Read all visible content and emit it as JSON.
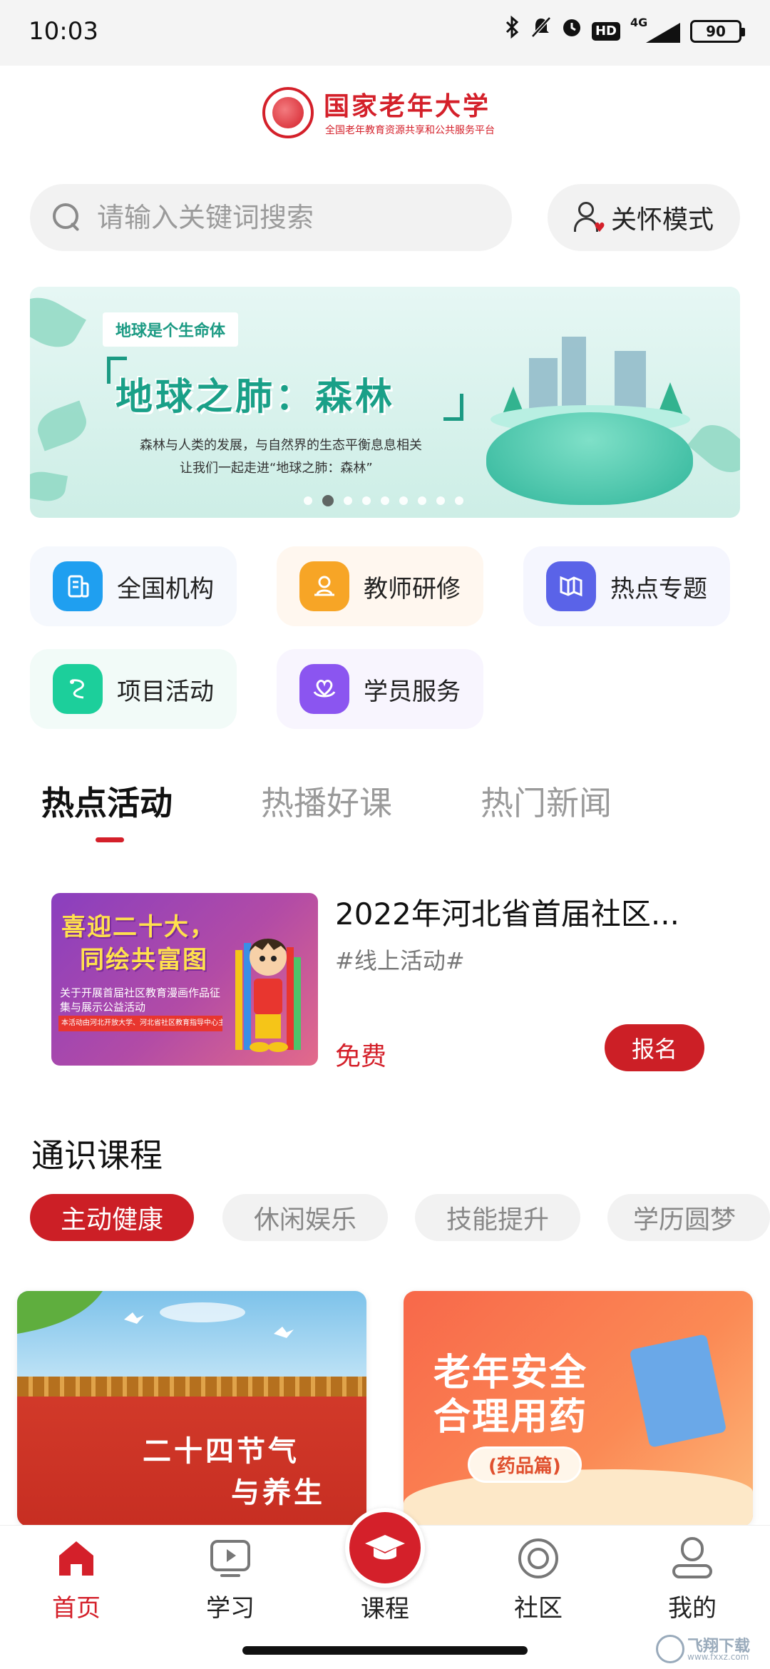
{
  "status_bar": {
    "time": "10:03",
    "hd": "HD",
    "network": "4G",
    "battery": "90"
  },
  "logo": {
    "title": "国家老年大学",
    "subtitle": "全国老年教育资源共享和公共服务平台"
  },
  "search": {
    "placeholder": "请输入关键词搜索"
  },
  "care_mode": {
    "label": "关怀模式"
  },
  "banner": {
    "tag": "地球是个生命体",
    "title": "地球之肺：森林",
    "line1": "森林与人类的发展，与自然界的生态平衡息息相关",
    "line2": "让我们一起走进“地球之肺：森林”",
    "dot_count": 9,
    "active_dot": 1
  },
  "quick_links": [
    {
      "label": "全国机构",
      "icon": "building-icon",
      "color": "#1f9ff0"
    },
    {
      "label": "教师研修",
      "icon": "teacher-icon",
      "color": "#f7a526"
    },
    {
      "label": "热点专题",
      "icon": "book-icon",
      "color": "#5a63e8"
    },
    {
      "label": "项目活动",
      "icon": "activity-icon",
      "color": "#1ccf9b"
    },
    {
      "label": "学员服务",
      "icon": "heart-hands-icon",
      "color": "#8b55f0"
    }
  ],
  "tabs": [
    {
      "label": "热点活动",
      "active": true
    },
    {
      "label": "热播好课",
      "active": false
    },
    {
      "label": "热门新闻",
      "active": false
    }
  ],
  "activity": {
    "title": "2022年河北省首届社区...",
    "tag": "#线上活动#",
    "price": "免费",
    "button": "报名",
    "image": {
      "headline1": "喜迎二十大，",
      "headline2": "同绘共富图",
      "desc": "关于开展首届社区教育漫画作品征集与展示公益活动",
      "footer": "本活动由河北开放大学、河北省社区教育指导中心主办"
    }
  },
  "courses": {
    "title": "通识课程",
    "chips": [
      {
        "label": "主动健康",
        "active": true
      },
      {
        "label": "休闲娱乐",
        "active": false
      },
      {
        "label": "技能提升",
        "active": false
      },
      {
        "label": "学历圆梦",
        "active": false
      }
    ],
    "cards": [
      {
        "line1": "二十四节气",
        "line2": "与养生"
      },
      {
        "line1": "老年安全",
        "line2": "合理用药",
        "pill": "(药品篇)"
      }
    ]
  },
  "bottom_nav": [
    {
      "label": "首页",
      "icon": "home-icon",
      "active": true
    },
    {
      "label": "学习",
      "icon": "play-icon",
      "active": false
    },
    {
      "label": "课程",
      "icon": "graduation-cap-icon",
      "active": false
    },
    {
      "label": "社区",
      "icon": "community-icon",
      "active": false
    },
    {
      "label": "我的",
      "icon": "profile-icon",
      "active": false
    }
  ],
  "watermark": {
    "title": "飞翔下载",
    "url": "www.fxxz.com"
  },
  "colors": {
    "brand_red": "#d4202a",
    "button_red": "#cc1f26",
    "banner_green": "#1aa088"
  }
}
